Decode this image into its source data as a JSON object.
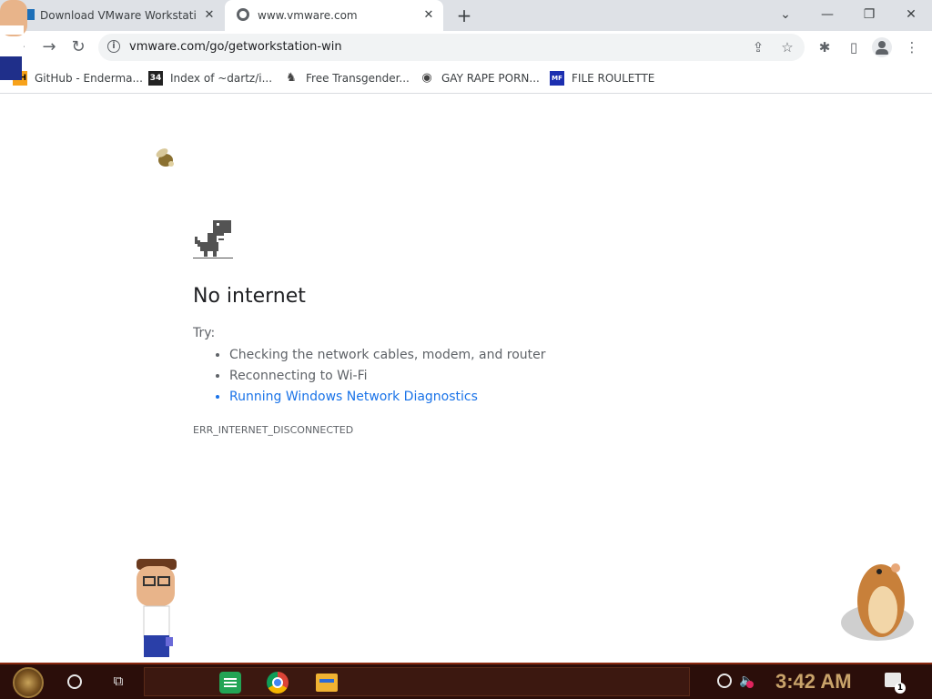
{
  "tabs": [
    {
      "label": "Download VMware Workstation",
      "close": "✕",
      "active": false
    },
    {
      "label": "www.vmware.com",
      "close": "✕",
      "active": true
    }
  ],
  "new_tab": "+",
  "window_controls": {
    "list": "⌄",
    "minimize": "—",
    "restore": "❐",
    "close": "✕"
  },
  "toolbar": {
    "back": "←",
    "forward": "→",
    "reload": "↻",
    "url": "vmware.com/go/getworkstation-win",
    "info_icon": "i",
    "share_icon": "⇪",
    "star_icon": "☆",
    "extensions_icon": "✱",
    "sidepanel_icon": "▯",
    "menu_icon": "⋮"
  },
  "bookmarks": [
    {
      "icon": "PH",
      "label": "GitHub - Enderma..."
    },
    {
      "icon": "34",
      "label": "Index of ~dartz/i..."
    },
    {
      "icon": "♞",
      "label": "Free Transgender..."
    },
    {
      "icon": "◉",
      "label": "GAY RAPE PORN..."
    },
    {
      "icon": "MF",
      "label": "FILE ROULETTE"
    }
  ],
  "error_page": {
    "headline": "No internet",
    "try_label": "Try:",
    "suggestions": [
      "Checking the network cables, modem, and router",
      "Reconnecting to Wi-Fi",
      "Running Windows Network Diagnostics"
    ],
    "error_code": "ERR_INTERNET_DISCONNECTED"
  },
  "taskbar": {
    "task_view_icon": "⧉",
    "volume_icon": "🔈",
    "clock": "3:42 AM",
    "notification_count": "1"
  },
  "colors": {
    "link": "#1a73e8",
    "taskbar": "#2b0e0a",
    "clock": "#c9a36a"
  }
}
